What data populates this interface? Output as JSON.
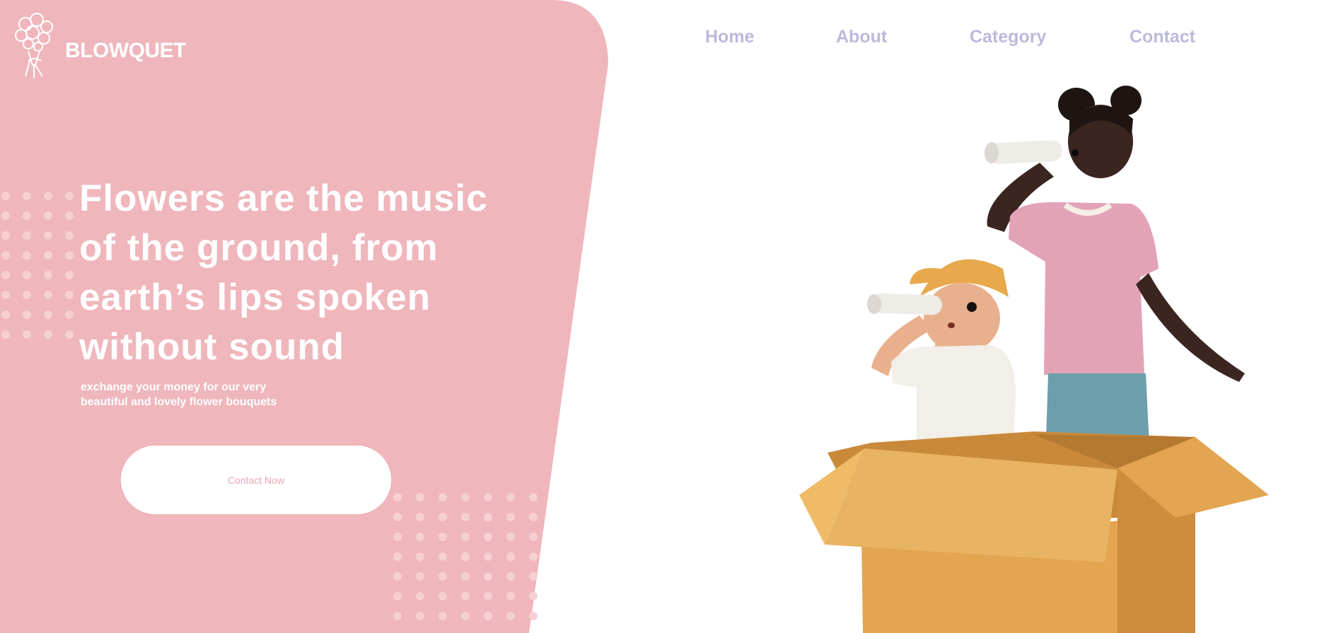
{
  "brand": {
    "name": "BLOWQUET",
    "logo_icon": "flower-bouquet-icon"
  },
  "nav": {
    "items": [
      "Home",
      "About",
      "Category",
      "Contact"
    ]
  },
  "hero": {
    "headline_lines": [
      "Flowers are the music",
      "of the ground, from",
      "earth’s lips spoken",
      "without sound"
    ],
    "subtext_lines": [
      "exchange your money for our very",
      "beautiful and lovely flower bouquets"
    ],
    "cta_label": "Contact Now"
  },
  "colors": {
    "pink_panel": "#efb6bc",
    "nav_text": "#bcbadb",
    "white": "#ffffff",
    "cta_text": "#e8a4b0",
    "box": "#e5ad5a"
  },
  "illustration": {
    "subject": "two-kids-in-cardboard-box-with-telescopes-icon"
  }
}
